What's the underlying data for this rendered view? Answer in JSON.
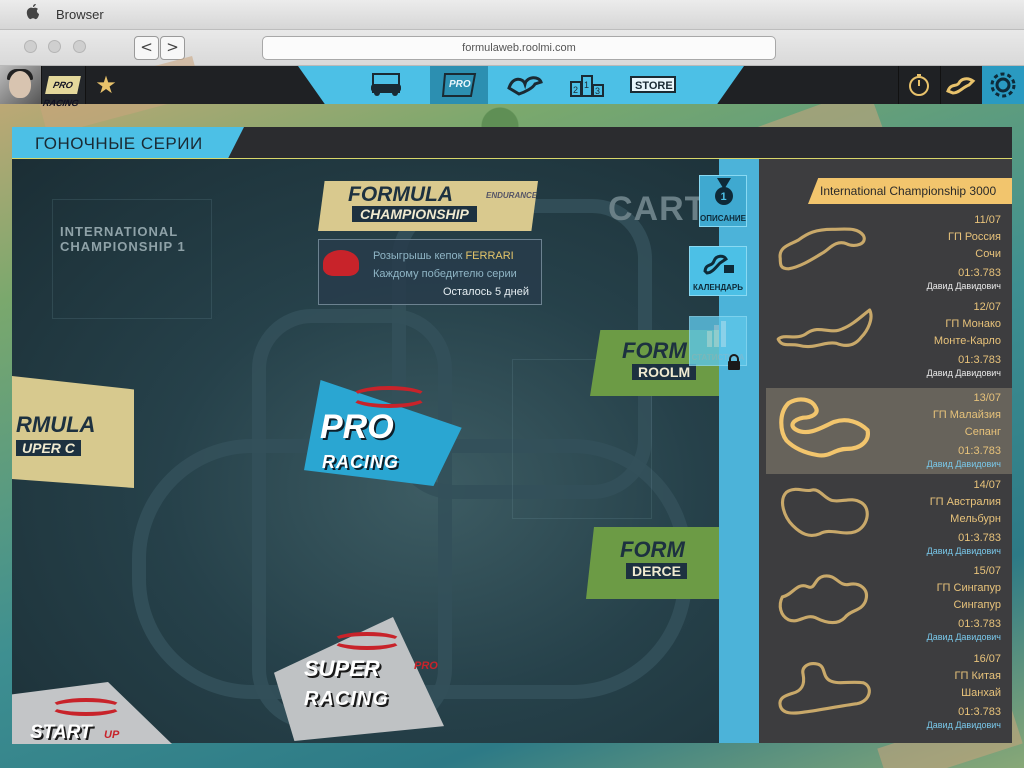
{
  "browser": {
    "app_name": "Browser",
    "url": "formulaweb.roolmi.com",
    "back": "<",
    "forward": ">"
  },
  "gamebar": {
    "pro_logo": "PRO RACING",
    "nav": [
      {
        "icon": "car-tickets-icon",
        "label": ""
      },
      {
        "icon": "pro-racing-icon",
        "label": "PRO RACING",
        "active": true
      },
      {
        "icon": "track-icon",
        "label": ""
      },
      {
        "icon": "podium-icon",
        "label": "2 1 3"
      },
      {
        "icon": "store-icon",
        "label": "STORE"
      }
    ]
  },
  "header": {
    "title": "ГОНОЧНЫЕ СЕРИИ"
  },
  "map": {
    "carts_text": "CARTS",
    "ic1_line1": "INTERNATIONAL",
    "ic1_line2": "CHAMPIONSHIP 1",
    "formula_champ": {
      "w1": "FORMULA",
      "w2": "CHAMPIONSHIP",
      "w3": "ENDURANCE"
    },
    "promo": {
      "line1_prefix": "Розыгрышь кепок ",
      "line1_highlight": "FERRARI",
      "line2": "Каждому победителю серии",
      "line3": "Осталось 5 дней"
    },
    "pro_racing": {
      "w1": "PRO",
      "w2": "RACING"
    },
    "formula_super": {
      "a": "RMULA",
      "b": "UPER C"
    },
    "formula_roolmi": {
      "a": "FORM",
      "b": "ROOLM"
    },
    "formula_dercer": {
      "a": "FORM",
      "b": "DERCE"
    },
    "super_pro": {
      "a": "SUPER",
      "b": "PRO",
      "c": "RACING"
    },
    "start_up": {
      "a": "START",
      "b": "UP"
    }
  },
  "side_tabs": {
    "description": "ОПИСАНИЕ",
    "calendar": "КАЛЕНДАРЬ",
    "statistics": "СТАТИСТИКА"
  },
  "panel": {
    "championship": "International Championship 3000",
    "races": [
      {
        "date": "11/07",
        "gp": "ГП Россия",
        "city": "Сочи",
        "time": "01:3.783",
        "driver": "Давид Давидович",
        "selected": false
      },
      {
        "date": "12/07",
        "gp": "ГП Монако",
        "city": "Монте-Карло",
        "time": "01:3.783",
        "driver": "Давид Давидович",
        "selected": false
      },
      {
        "date": "13/07",
        "gp": "ГП Малайзия",
        "city": "Сепанг",
        "time": "01:3.783",
        "driver": "Давид Давидович",
        "selected": true
      },
      {
        "date": "14/07",
        "gp": "ГП Австралия",
        "city": "Мельбурн",
        "time": "01:3.783",
        "driver": "Давид Давидович",
        "selected": false
      },
      {
        "date": "15/07",
        "gp": "ГП Сингапур",
        "city": "Сингапур",
        "time": "01:3.783",
        "driver": "Давид Давидович",
        "selected": false
      },
      {
        "date": "16/07",
        "gp": "ГП Китая",
        "city": "Шанхай",
        "time": "01:3.783",
        "driver": "Давид Давидович",
        "selected": false
      }
    ]
  },
  "colors": {
    "accent_blue": "#4cc0e6",
    "gold": "#f2c56d",
    "track_line": "#e7c27a",
    "selected_row": "#67635b"
  }
}
